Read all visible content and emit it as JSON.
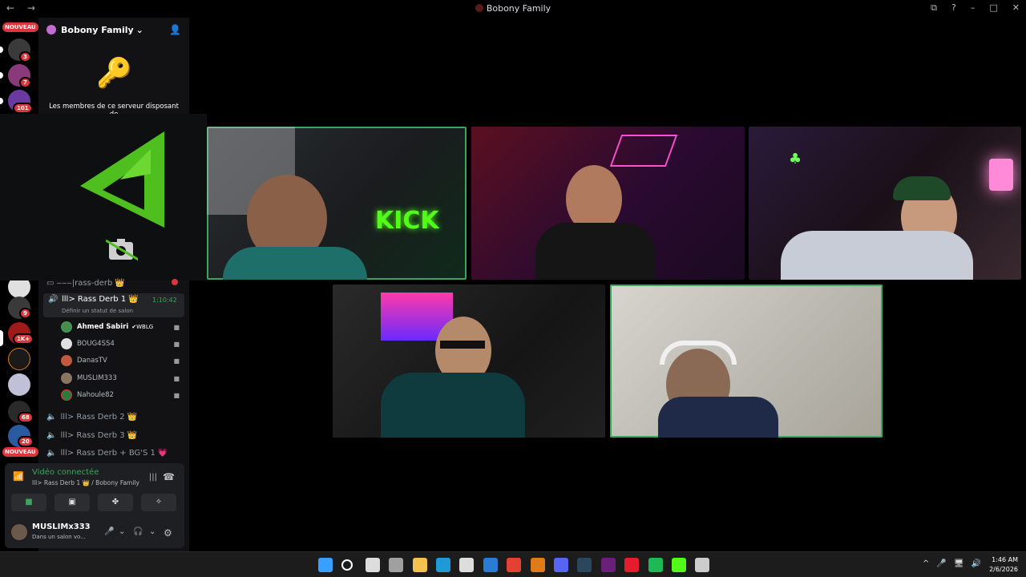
{
  "window": {
    "title": "Bobony Family",
    "nav": "← →",
    "controls": [
      "⧉",
      "?",
      "–",
      "□",
      "✕"
    ]
  },
  "servers": {
    "nouveau_top": "NOUVEAU",
    "nouveau_bottom": "NOUVEAU",
    "badges": [
      "3",
      "7",
      "101",
      "9",
      "1K+",
      "68",
      "20"
    ]
  },
  "guild": {
    "name": "Bobony Family",
    "chevron": "⌄",
    "boost_message": "Les membres de ce serveur disposant de"
  },
  "channels": {
    "partial_channel": "▭ ‒‒‒|rass-derb",
    "active_voice": {
      "name": "lll> Rass Derb 1",
      "timer": "1:10:42",
      "status_hint": "Définir un statut de salon",
      "members": [
        {
          "name": "Ahmed Sabiri",
          "tag": "WBLG",
          "color": "#4b8a4f"
        },
        {
          "name": "BOUG4SS4",
          "color": "#e0e0e0"
        },
        {
          "name": "DanasTV",
          "color": "#c05a3e"
        },
        {
          "name": "MUSLIM333",
          "color": "#8a7560"
        },
        {
          "name": "Nahoule82",
          "color": "#2f7a3a"
        }
      ]
    },
    "other_voice": [
      "lll> Rass Derb 2",
      "lll> Rass Derb 3",
      "lll> Rass Derb + BG'S 1"
    ]
  },
  "voice_panel": {
    "status": "Vidéo connectée",
    "location": "lll> Rass Derb 1 👑 / Bobony Family",
    "buttons": [
      "video",
      "screen-share",
      "activities",
      "soundboard"
    ],
    "user_name": "MUSLIMx333",
    "user_status": "Dans un salon vo..."
  },
  "taskbar": {
    "time": "1:46 AM",
    "date": "2/6/2026",
    "tray_icons": [
      "^",
      "🎤",
      "🖥",
      "🔊"
    ],
    "apps": [
      {
        "name": "start",
        "color": "#3aa0ff"
      },
      {
        "name": "search",
        "color": "#ffffff"
      },
      {
        "name": "task-view",
        "color": "#dddddd"
      },
      {
        "name": "settings",
        "color": "#a0a0a0"
      },
      {
        "name": "explorer",
        "color": "#f2c14e"
      },
      {
        "name": "edge",
        "color": "#1e9bd7"
      },
      {
        "name": "store",
        "color": "#dddddd"
      },
      {
        "name": "outlook",
        "color": "#2a7bd4"
      },
      {
        "name": "chrome",
        "color": "#e44134"
      },
      {
        "name": "app-a",
        "color": "#e07b1a"
      },
      {
        "name": "discord",
        "color": "#5865f2"
      },
      {
        "name": "steam",
        "color": "#2a475e"
      },
      {
        "name": "next",
        "color": "#6a1f7a"
      },
      {
        "name": "opera",
        "color": "#e31d2b"
      },
      {
        "name": "spotify",
        "color": "#1db954"
      },
      {
        "name": "kick",
        "color": "#53fc18"
      },
      {
        "name": "app-b",
        "color": "#cccccc"
      }
    ]
  }
}
